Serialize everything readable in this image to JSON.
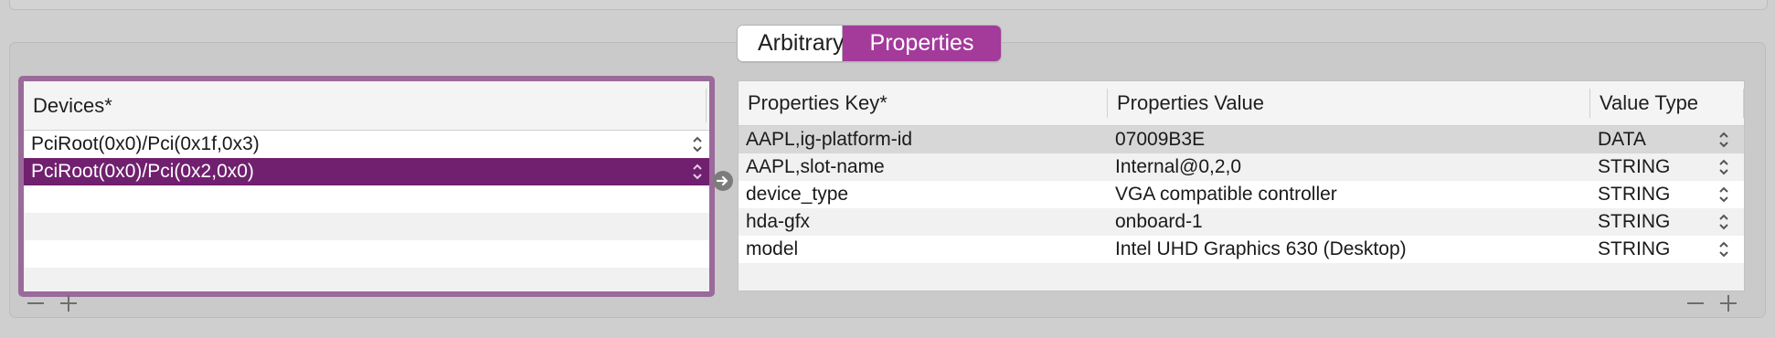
{
  "tabs": [
    {
      "label": "Arbitrary",
      "active": false
    },
    {
      "label": "Properties",
      "active": true
    }
  ],
  "devices": {
    "header": "Devices*",
    "rows": [
      {
        "name": "PciRoot(0x0)/Pci(0x1f,0x3)",
        "selected": false
      },
      {
        "name": "PciRoot(0x0)/Pci(0x2,0x0)",
        "selected": true
      }
    ]
  },
  "properties": {
    "headers": {
      "key": "Properties Key*",
      "value": "Properties Value",
      "type": "Value Type"
    },
    "rows": [
      {
        "key": "AAPL,ig-platform-id",
        "value": "07009B3E",
        "type": "DATA"
      },
      {
        "key": "AAPL,slot-name",
        "value": "Internal@0,2,0",
        "type": "STRING"
      },
      {
        "key": "device_type",
        "value": "VGA compatible controller",
        "type": "STRING"
      },
      {
        "key": "hda-gfx",
        "value": "onboard-1",
        "type": "STRING"
      },
      {
        "key": "model",
        "value": "Intel UHD Graphics 630 (Desktop)",
        "type": "STRING"
      }
    ]
  },
  "colors": {
    "accent": "#a43a9a",
    "selection": "#70206f",
    "focus_ring": "#9a6a9a"
  },
  "icons": {
    "stepper": "up-down-chevron-icon",
    "arrow": "arrow-right-circle-icon",
    "minus": "minus-icon",
    "plus": "plus-icon"
  }
}
